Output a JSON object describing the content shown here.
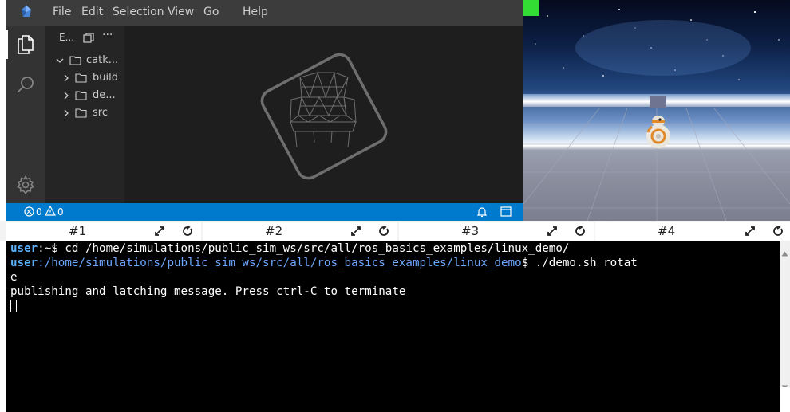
{
  "menu": {
    "items": [
      "File",
      "Edit",
      "Selection",
      "View",
      "Go",
      "Help"
    ]
  },
  "explorer": {
    "title": "E...",
    "items": [
      {
        "label": "catk..."
      },
      {
        "label": "build"
      },
      {
        "label": "de..."
      },
      {
        "label": "src"
      }
    ]
  },
  "status": {
    "errors": "0",
    "warnings": "0"
  },
  "terminal_tabs": [
    {
      "label": "#1"
    },
    {
      "label": "#2"
    },
    {
      "label": "#3"
    },
    {
      "label": "#4"
    }
  ],
  "terminal": {
    "line1": {
      "user": "user",
      "rest": ":~$ cd /home/simulations/public_sim_ws/src/all/ros_basics_examples/linux_demo/"
    },
    "line2": {
      "user": "user",
      "path": ":/home/simulations/public_sim_ws/src/all/ros_basics_examples/linux_demo",
      "cmd": "$ ./demo.sh rotat"
    },
    "line3": "e",
    "line4": "publishing and latching message. Press ctrl-C to terminate"
  },
  "colors": {
    "status_bar": "#007acc",
    "terminal_bg": "#000000",
    "prompt_user": "#5ab0ff"
  }
}
